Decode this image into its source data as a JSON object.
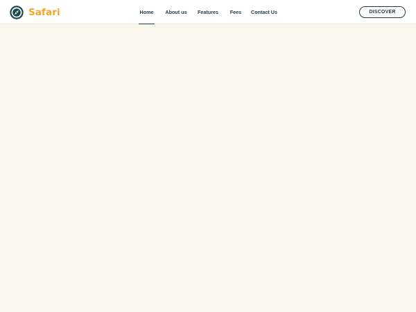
{
  "brand": {
    "name": "Safari",
    "color": "#f5a623",
    "icon": "compass-icon"
  },
  "nav": {
    "items": [
      {
        "label": "Home",
        "active": true
      },
      {
        "label": "About us",
        "active": false
      },
      {
        "label": "Features",
        "active": false
      },
      {
        "label": "Fees",
        "active": false
      },
      {
        "label": "Contact Us",
        "active": false
      }
    ]
  },
  "header": {
    "cta_label": "DISCOVER"
  },
  "colors": {
    "primary": "#1e3a4a",
    "accent": "#f5a623",
    "background": "#f9f7ec",
    "navbar": "#ffffff"
  }
}
